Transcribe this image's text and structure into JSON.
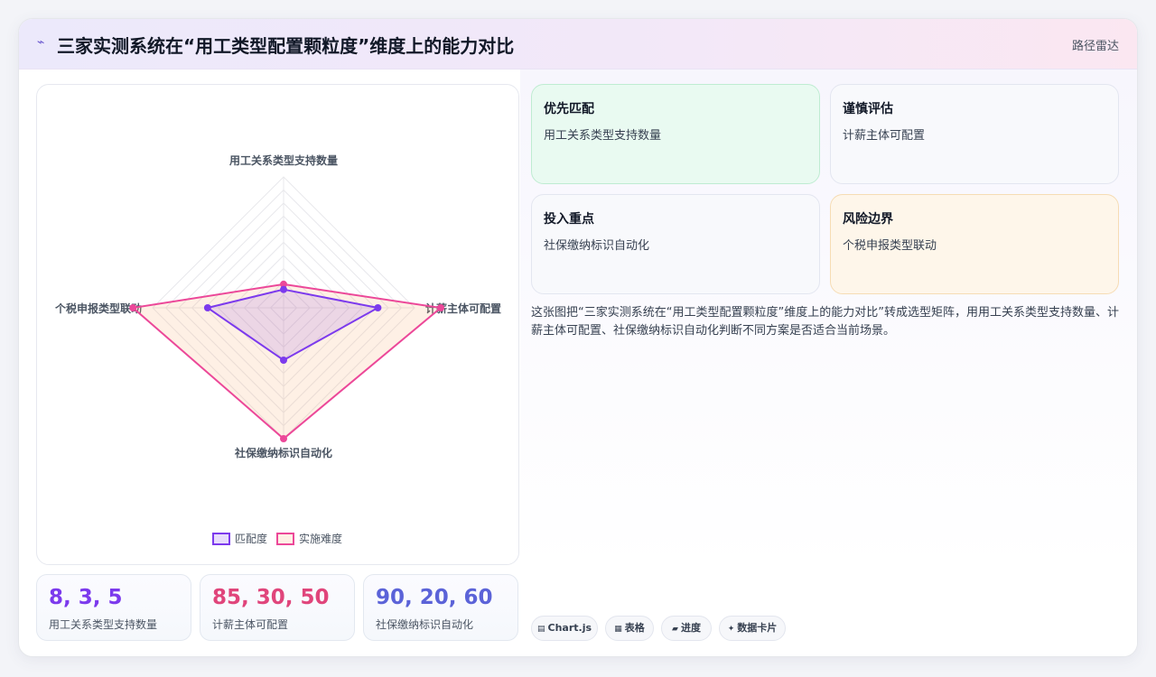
{
  "header": {
    "icon": "lightning-icon",
    "title": "三家实测系统在“用工类型配置颗粒度”维度上的能力对比",
    "tag": "路径雷达"
  },
  "chart_data": {
    "type": "radar",
    "axes": [
      "用工关系类型支持数量",
      "计薪主体可配置",
      "社保缴纳标识自动化",
      "个税申报类型联动"
    ],
    "range": [
      0,
      100
    ],
    "grid_levels": 10,
    "legend_position": "bottom",
    "series": [
      {
        "name": "匹配度",
        "values": [
          14,
          72,
          40,
          58
        ],
        "color": "#7c3aed",
        "fill": "rgba(124,58,237,0.14)"
      },
      {
        "name": "实施难度",
        "values": [
          18,
          120,
          100,
          115
        ],
        "color": "#ec4899",
        "fill": "rgba(250,170,110,0.18)"
      }
    ]
  },
  "stats": [
    {
      "value": "8, 3, 5",
      "label": "用工关系类型支持数量",
      "color": "#7c3aed"
    },
    {
      "value": "85, 30, 50",
      "label": "计薪主体可配置",
      "color": "#e0457b"
    },
    {
      "value": "90, 20, 60",
      "label": "社保缴纳标识自动化",
      "color": "#5b63d8"
    }
  ],
  "boxes": [
    {
      "title": "优先匹配",
      "sub": "用工关系类型支持数量"
    },
    {
      "title": "谨慎评估",
      "sub": "计薪主体可配置"
    },
    {
      "title": "投入重点",
      "sub": "社保缴纳标识自动化"
    },
    {
      "title": "风险边界",
      "sub": "个税申报类型联动"
    }
  ],
  "description": "这张图把“三家实测系统在“用工类型配置颗粒度”维度上的能力对比”转成选型矩阵，用用工关系类型支持数量、计薪主体可配置、社保缴纳标识自动化判断不同方案是否适合当前场景。",
  "chips": [
    {
      "icon": "chart-icon",
      "label": "Chart.js"
    },
    {
      "icon": "table-icon",
      "label": "表格"
    },
    {
      "icon": "progress-icon",
      "label": "进度"
    },
    {
      "icon": "sparkle-icon",
      "label": "数据卡片"
    }
  ]
}
